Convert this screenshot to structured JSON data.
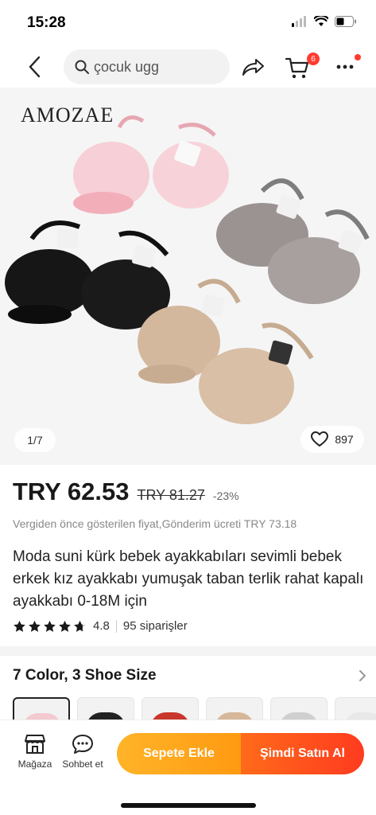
{
  "status": {
    "time": "15:28"
  },
  "nav": {
    "search_text": "çocuk ugg",
    "cart_count": "6"
  },
  "gallery": {
    "brand": "AMOZAE",
    "counter": "1/7",
    "favorites": "897"
  },
  "price": {
    "current": "TRY 62.53",
    "original": "TRY 81.27",
    "discount": "-23%",
    "note": "Vergiden önce gösterilen fiyat,Gönderim ücreti TRY 73.18"
  },
  "product": {
    "title": "Moda suni kürk bebek ayakkabıları sevimli bebek erkek kız ayakkabı yumuşak taban terlik rahat kapalı ayakkabı 0-18M için",
    "rating": "4.8",
    "orders": "95 siparişler"
  },
  "variants": {
    "title": "7 Color, 3 Shoe Size",
    "thumb_colors": [
      "#f4c9cf",
      "#222222",
      "#c9372c",
      "#d6b79a",
      "#cfcfcf",
      "#e8e8e8"
    ]
  },
  "bottom": {
    "store_label": "Mağaza",
    "chat_label": "Sohbet et",
    "add_cart_label": "Sepete Ekle",
    "buy_now_label": "Şimdi Satın Al"
  },
  "colors": {
    "accent_orange": "#ff9a12",
    "accent_red": "#ff3b1f",
    "badge_red": "#ff3b30"
  }
}
